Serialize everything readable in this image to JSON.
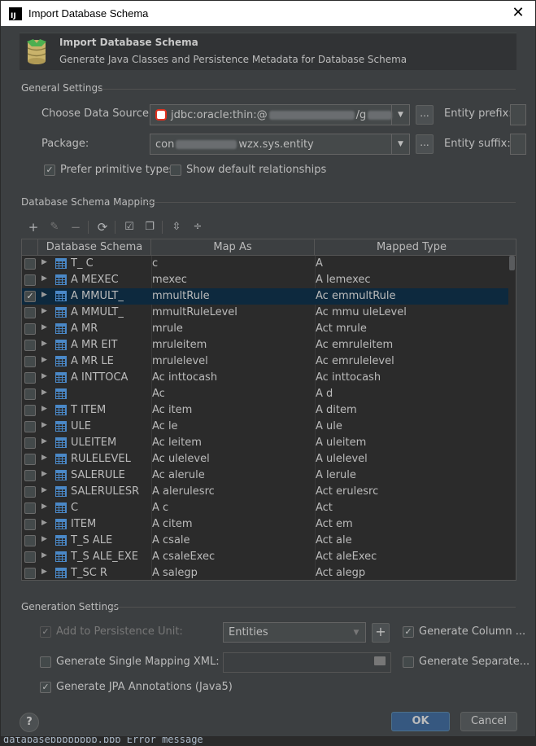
{
  "window": {
    "title": "Import Database Schema",
    "close_glyph": "✕"
  },
  "banner": {
    "title": "Import Database Schema",
    "subtitle": "Generate Java Classes and Persistence Metadata for Database Schema"
  },
  "general": {
    "section_label": "General Settings",
    "data_source_label": "Choose Data Source:",
    "data_source_value": "jdbc:oracle:thin:@",
    "data_source_tail": "/g",
    "package_label": "Package:",
    "package_prefix": "con",
    "package_value": "wzx.sys.entity",
    "dots_label": "...",
    "entity_prefix_label": "Entity prefix:",
    "entity_suffix_label": "Entity suffix:",
    "prefer_primitive_label": "Prefer primitive types",
    "prefer_primitive_checked": true,
    "show_default_rel_label": "Show default relationships",
    "show_default_rel_checked": false
  },
  "mapping": {
    "section_label": "Database Schema Mapping",
    "columns": [
      "Database Schema",
      "Map As",
      "Mapped Type"
    ],
    "rows": [
      {
        "schema": "T_   C",
        "map_as": "c",
        "type": "A",
        "checked": false,
        "selected": false
      },
      {
        "schema": "A   MEXEC",
        "map_as": "mexec",
        "type": "A   lemexec",
        "checked": false,
        "selected": false
      },
      {
        "schema": "A   MMULT_",
        "map_as": "mmultRule",
        "type": "Ac   emmultRule",
        "checked": true,
        "selected": true
      },
      {
        "schema": "A   MMULT_",
        "map_as": "mmultRuleLevel",
        "type": "Ac   mmu   uleLevel",
        "checked": false,
        "selected": false
      },
      {
        "schema": "A   MR",
        "map_as": "mrule",
        "type": "Act   mrule",
        "checked": false,
        "selected": false
      },
      {
        "schema": "A   MR   EIT",
        "map_as": "mruleitem",
        "type": "Ac   emruleitem",
        "checked": false,
        "selected": false
      },
      {
        "schema": "A   MR   LE",
        "map_as": "mrulelevel",
        "type": "Ac   emrulelevel",
        "checked": false,
        "selected": false
      },
      {
        "schema": "A   INTTOCA",
        "map_as": "Ac   inttocash",
        "type": "Ac   inttocash",
        "checked": false,
        "selected": false
      },
      {
        "schema": "",
        "map_as": "Ac",
        "type": "A   d",
        "checked": false,
        "selected": false
      },
      {
        "schema": "T   ITEM",
        "map_as": "Ac   item",
        "type": "A   ditem",
        "checked": false,
        "selected": false
      },
      {
        "schema": "   ULE",
        "map_as": "Ac   le",
        "type": "A   ule",
        "checked": false,
        "selected": false
      },
      {
        "schema": "   ULEITEM",
        "map_as": "Ac   leitem",
        "type": "A   uleitem",
        "checked": false,
        "selected": false
      },
      {
        "schema": "   RULELEVEL",
        "map_as": "Ac   ulelevel",
        "type": "A   ulelevel",
        "checked": false,
        "selected": false
      },
      {
        "schema": "   SALERULE",
        "map_as": "Ac   alerule",
        "type": "A   lerule",
        "checked": false,
        "selected": false
      },
      {
        "schema": "   SALERULESR",
        "map_as": "A   alerulesrc",
        "type": "Act   erulesrc",
        "checked": false,
        "selected": false
      },
      {
        "schema": "   C",
        "map_as": "A   c",
        "type": "Act",
        "checked": false,
        "selected": false
      },
      {
        "schema": "   ITEM",
        "map_as": "A   citem",
        "type": "Act   em",
        "checked": false,
        "selected": false
      },
      {
        "schema": "T_S   ALE",
        "map_as": "A   csale",
        "type": "Act   ale",
        "checked": false,
        "selected": false
      },
      {
        "schema": "T_S   ALE_EXE",
        "map_as": "A   csaleExec",
        "type": "Act   aleExec",
        "checked": false,
        "selected": false
      },
      {
        "schema": "T_SC   R",
        "map_as": "A   salegp",
        "type": "Act   alegp",
        "checked": false,
        "selected": false
      }
    ]
  },
  "generation": {
    "section_label": "Generation Settings",
    "add_persistence_label": "Add to Persistence Unit:",
    "add_persistence_checked": true,
    "persistence_value": "Entities",
    "plus_label": "+",
    "generate_column_label": "Generate Column ...",
    "generate_column_checked": true,
    "single_mapping_label": "Generate Single Mapping XML:",
    "single_mapping_checked": false,
    "generate_separate_label": "Generate Separate...",
    "generate_separate_checked": false,
    "jpa_label": "Generate JPA Annotations (Java5)",
    "jpa_checked": true
  },
  "footer": {
    "help_label": "?",
    "ok_label": "OK",
    "cancel_label": "Cancel"
  },
  "background": {
    "console_text": "databasebbbbbbbb.bbb   Error message"
  },
  "colors": {
    "dialog_bg": "#3c3f41",
    "selection": "#0d293e",
    "ok_button": "#365880"
  }
}
